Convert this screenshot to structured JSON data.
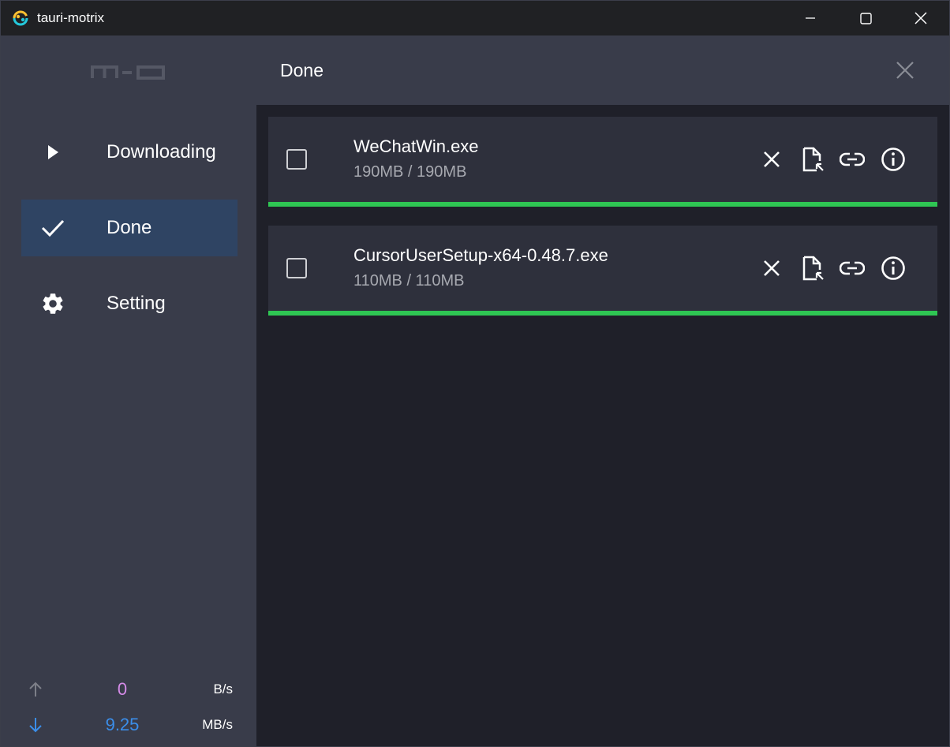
{
  "window": {
    "title": "tauri-motrix"
  },
  "sidebar": {
    "logo_text": "m-o",
    "items": [
      {
        "label": "Downloading",
        "icon": "play-icon",
        "active": false
      },
      {
        "label": "Done",
        "icon": "check-icon",
        "active": true
      },
      {
        "label": "Setting",
        "icon": "gear-icon",
        "active": false
      }
    ],
    "upload": {
      "value": "0",
      "unit": "B/s",
      "color": "#d58be8",
      "icon": "arrow-up-icon"
    },
    "download": {
      "value": "9.25",
      "unit": "MB/s",
      "color": "#3b8eea",
      "icon": "arrow-down-icon"
    }
  },
  "header": {
    "title": "Done",
    "close_icon": "close-icon"
  },
  "tasks": [
    {
      "name": "WeChatWin.exe",
      "size": "190MB / 190MB",
      "progress": 1.0,
      "checked": false
    },
    {
      "name": "CursorUserSetup-x64-0.48.7.exe",
      "size": "110MB / 110MB",
      "progress": 1.0,
      "checked": false
    }
  ],
  "task_action_icons": [
    "close-icon",
    "open-file-icon",
    "link-icon",
    "info-icon"
  ],
  "colors": {
    "sidebar_bg": "#393c4a",
    "active_bg": "#2f4463",
    "main_bg": "#1f2029",
    "task_bg": "#2e303c",
    "progress": "#2fc653"
  }
}
